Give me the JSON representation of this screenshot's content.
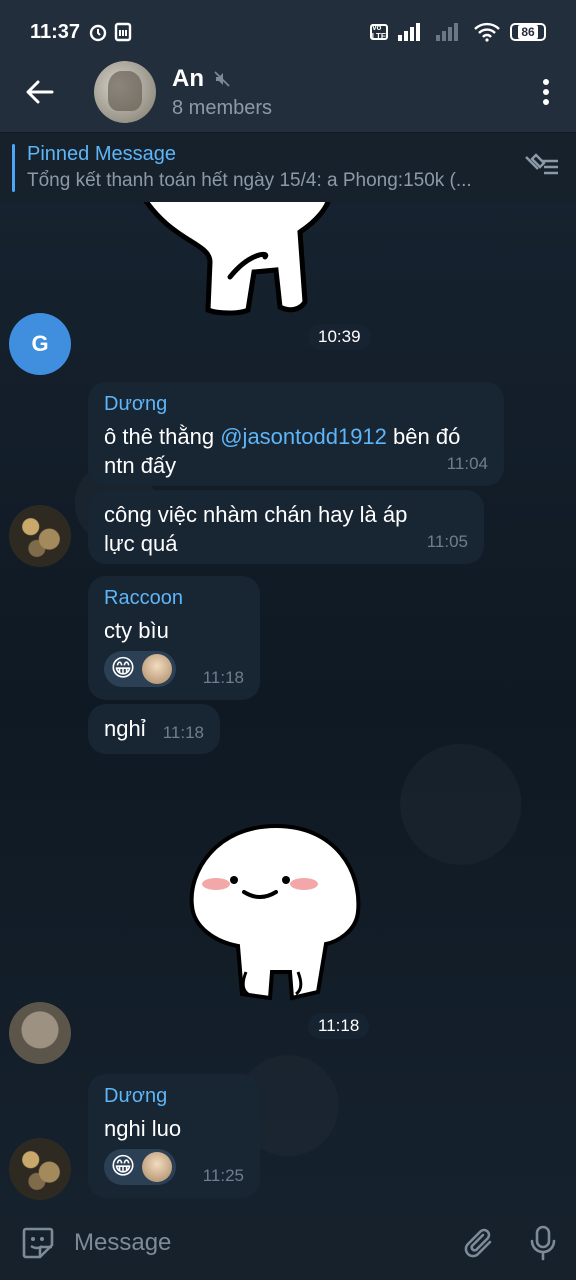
{
  "status_bar": {
    "time": "11:37",
    "battery": "86",
    "volte_label": "Vo LTE"
  },
  "header": {
    "title": "An",
    "subtitle": "8 members"
  },
  "pinned": {
    "label": "Pinned Message",
    "preview": "Tổng kết thanh toán hết ngày 15/4: a Phong:150k (..."
  },
  "messages": {
    "sticker_time_1": "10:39",
    "avatar_g_letter": "G",
    "m1": {
      "sender": "Dương",
      "sender_color": "#5eb5f7",
      "text_before": "ô thê thằng ",
      "mention": "@jasontodd1912",
      "text_after": " bên đó ntn đấy",
      "time": "11:04"
    },
    "m2": {
      "text": "công việc nhàm chán hay là áp lực quá",
      "time": "11:05"
    },
    "m3": {
      "sender": "Raccoon",
      "sender_color": "#5eb5f7",
      "text": "cty bìu",
      "time": "11:18",
      "reaction_emoji": "😁"
    },
    "m4": {
      "text": "nghỉ",
      "time": "11:18"
    },
    "sticker_time_2": "11:18",
    "m5": {
      "sender": "Dương",
      "sender_color": "#5eb5f7",
      "text": "nghi luo",
      "time": "11:25",
      "reaction_emoji": "😁"
    }
  },
  "input": {
    "placeholder": "Message"
  }
}
